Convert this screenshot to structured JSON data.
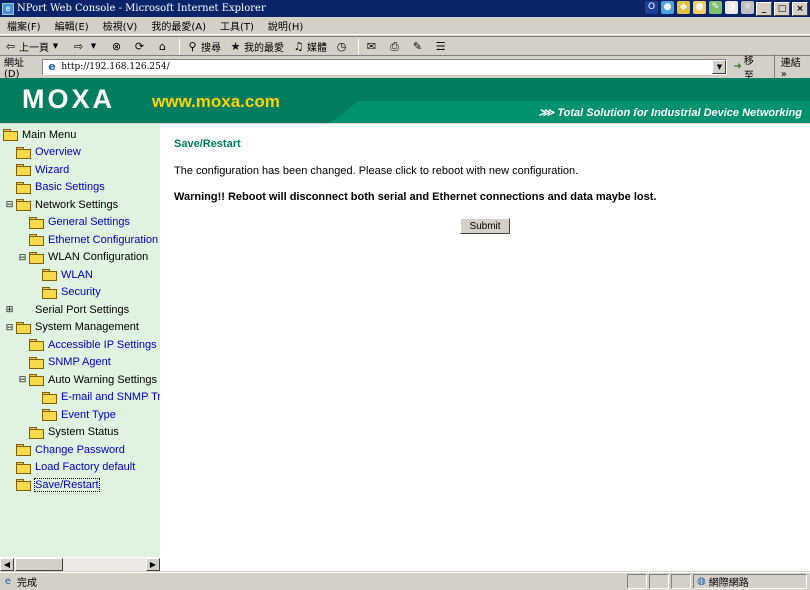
{
  "window": {
    "title": "NPort Web Console - Microsoft Internet Explorer",
    "app_icon": "ie-icon",
    "controls": [
      "_",
      "□",
      "×"
    ]
  },
  "menubar": {
    "items": [
      "檔案(F)",
      "編輯(E)",
      "檢視(V)",
      "我的最愛(A)",
      "工具(T)",
      "說明(H)"
    ]
  },
  "toolbar": {
    "back_label": "上一頁",
    "search_label": "搜尋",
    "favorites_label": "我的最愛",
    "media_label": "媒體"
  },
  "addressbar": {
    "label": "網址(D)",
    "url": "http://192.168.126.254/",
    "go_label": "移至",
    "links_label": "連結 »"
  },
  "banner": {
    "logo": "MOXA",
    "site": "www.moxa.com",
    "tagline": "⋙ Total Solution for Industrial Device Networking"
  },
  "sidebar": {
    "items": [
      {
        "label": "Main Menu",
        "level": 0,
        "link": false,
        "expander": "",
        "open": true
      },
      {
        "label": "Overview",
        "level": 1,
        "link": true,
        "expander": "",
        "open": false
      },
      {
        "label": "Wizard",
        "level": 1,
        "link": true,
        "expander": "",
        "open": false
      },
      {
        "label": "Basic Settings",
        "level": 1,
        "link": true,
        "expander": "",
        "open": false
      },
      {
        "label": "Network Settings",
        "level": 1,
        "link": false,
        "expander": "⊟",
        "open": true
      },
      {
        "label": "General Settings",
        "level": 2,
        "link": true,
        "expander": "",
        "open": false
      },
      {
        "label": "Ethernet Configuration",
        "level": 2,
        "link": true,
        "expander": "",
        "open": false
      },
      {
        "label": "WLAN Configuration",
        "level": 2,
        "link": false,
        "expander": "⊟",
        "open": true
      },
      {
        "label": "WLAN",
        "level": 3,
        "link": true,
        "expander": "",
        "open": false
      },
      {
        "label": "Security",
        "level": 3,
        "link": true,
        "expander": "",
        "open": false
      },
      {
        "label": "Serial Port Settings",
        "level": 1,
        "link": false,
        "expander": "⊞",
        "open": false
      },
      {
        "label": "System Management",
        "level": 1,
        "link": false,
        "expander": "⊟",
        "open": true
      },
      {
        "label": "Accessible IP Settings",
        "level": 2,
        "link": true,
        "expander": "",
        "open": false
      },
      {
        "label": "SNMP Agent",
        "level": 2,
        "link": true,
        "expander": "",
        "open": false
      },
      {
        "label": "Auto Warning Settings",
        "level": 2,
        "link": false,
        "expander": "⊟",
        "open": true
      },
      {
        "label": "E-mail and SNMP Trap",
        "level": 3,
        "link": true,
        "expander": "",
        "open": false
      },
      {
        "label": "Event Type",
        "level": 3,
        "link": true,
        "expander": "",
        "open": false
      },
      {
        "label": "System Status",
        "level": 2,
        "link": false,
        "expander": "",
        "open": false
      },
      {
        "label": "Change Password",
        "level": 1,
        "link": true,
        "expander": "",
        "open": false
      },
      {
        "label": "Load Factory default",
        "level": 1,
        "link": true,
        "expander": "",
        "open": false
      },
      {
        "label": "Save/Restart",
        "level": 1,
        "link": true,
        "expander": "",
        "open": false,
        "selected": true
      }
    ]
  },
  "main": {
    "title": "Save/Restart",
    "message": "The configuration has been changed. Please click to reboot with new configuration.",
    "warning": "Warning!! Reboot will disconnect both serial and Ethernet connections and data maybe lost.",
    "submit_label": "Submit"
  },
  "statusbar": {
    "status": "完成",
    "zone": "網際網路"
  },
  "colors": {
    "brand_green": "#007c5e",
    "brand_yellow": "#ffd200",
    "sidebar_bg": "#e0f3e0",
    "link_blue": "#0000cc"
  }
}
